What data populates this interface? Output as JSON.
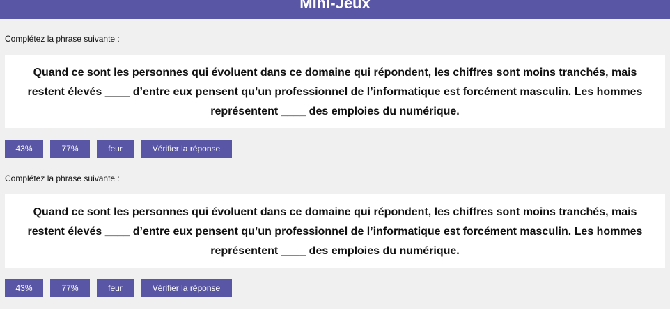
{
  "header": {
    "title": "Mini-Jeux"
  },
  "exercises": [
    {
      "prompt": "Complétez la phrase suivante :",
      "sentence": "Quand ce sont les personnes qui évoluent dans ce domaine qui répondent, les chiffres sont moins tranchés, mais restent élevés ____ d’entre eux pensent qu’un professionnel de l’informatique est forcément masculin. Les hommes représentent ____ des emploies du numérique.",
      "options": [
        "43%",
        "77%",
        "feur"
      ],
      "verify_label": "Vérifier la réponse"
    },
    {
      "prompt": "Complétez la phrase suivante :",
      "sentence": "Quand ce sont les personnes qui évoluent dans ce domaine qui répondent, les chiffres sont moins tranchés, mais restent élevés ____ d’entre eux pensent qu’un professionnel de l’informatique est forcément masculin. Les hommes représentent ____ des emploies du numérique.",
      "options": [
        "43%",
        "77%",
        "feur"
      ],
      "verify_label": "Vérifier la réponse"
    }
  ],
  "colors": {
    "accent": "#5a56a6",
    "background": "#f0f0f0",
    "card": "#ffffff"
  }
}
